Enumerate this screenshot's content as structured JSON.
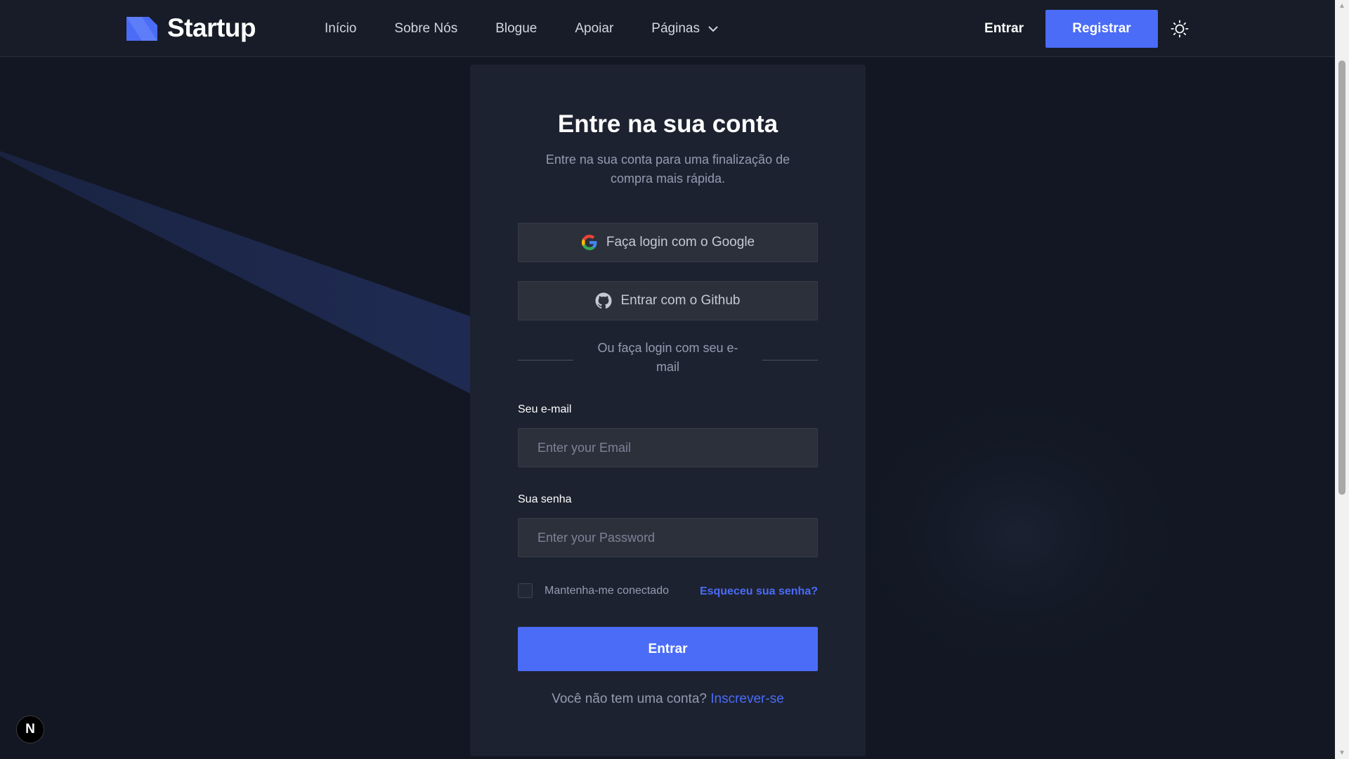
{
  "header": {
    "logo_text": "Startup",
    "nav": {
      "items": [
        {
          "label": "Início"
        },
        {
          "label": "Sobre Nós"
        },
        {
          "label": "Blogue"
        },
        {
          "label": "Apoiar"
        },
        {
          "label": "Páginas"
        }
      ]
    },
    "signin_label": "Entrar",
    "signup_label": "Registrar",
    "theme_icon": "sun-icon"
  },
  "login": {
    "title": "Entre na sua conta",
    "subtitle": "Entre na sua conta para uma finalização de compra mais rápida.",
    "google_label": "Faça login com o Google",
    "github_label": "Entrar com o Github",
    "divider_text": "Ou faça login com seu e-mail",
    "email": {
      "label": "Seu e-mail",
      "placeholder": "Enter your Email",
      "value": ""
    },
    "password": {
      "label": "Sua senha",
      "placeholder": "Enter your Password",
      "value": ""
    },
    "remember_label": "Mantenha-me conectado",
    "forgot_label": "Esqueceu sua senha?",
    "submit_label": "Entrar",
    "no_account_text": "Você não tem uma conta?",
    "signup_link": "Inscrever-se"
  },
  "badge": {
    "label": "N"
  },
  "colors": {
    "accent": "#4a6cf7",
    "background": "#121723",
    "card": "#1d2230",
    "header": "#171c28"
  }
}
